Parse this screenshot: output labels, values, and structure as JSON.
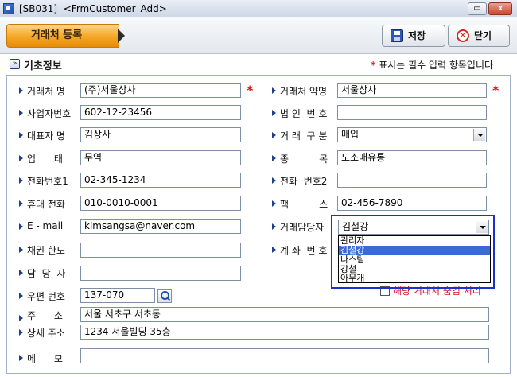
{
  "window": {
    "title": "[SB031]  <FrmCustomer_Add>",
    "close_glyph": "x",
    "restore_glyph": "▭"
  },
  "header": {
    "tab_label": "거래처 등록",
    "save_label": "저장",
    "close_label": "닫기",
    "close_icon_glyph": "✕"
  },
  "section": {
    "title": "기초정보",
    "icon_glyph": "»",
    "required_star": "*",
    "required_note": " 표시는 필수 입력 항목입니다"
  },
  "form": {
    "required_mark": "*",
    "left": [
      {
        "label": "거래처 명",
        "value": "(주)서울상사"
      },
      {
        "label": "사업자번호",
        "value": "602-12-23456"
      },
      {
        "label": "대표자 명",
        "value": "김상사"
      },
      {
        "label": "업      태",
        "value": "무역"
      },
      {
        "label": "전화번호1",
        "value": "02-345-1234"
      },
      {
        "label": "휴대 전화",
        "value": "010-0010-0001"
      },
      {
        "label": "E - mail",
        "value": "kimsangsa@naver.com"
      },
      {
        "label": "채권 한도",
        "value": ""
      },
      {
        "label": "담  당  자",
        "value": ""
      },
      {
        "label": "우편 번호",
        "value": "137-070"
      }
    ],
    "right": [
      {
        "label": "거래처 약명",
        "value": "서울상사"
      },
      {
        "label": "법 인  번 호",
        "value": ""
      },
      {
        "label": "거 래  구 분",
        "value": "매입"
      },
      {
        "label": "종          목",
        "value": "도소매유통"
      },
      {
        "label": "전화  번호2",
        "value": ""
      },
      {
        "label": "팩          스",
        "value": "02-456-7890"
      },
      {
        "label": "거래담당자",
        "value": "김철강"
      },
      {
        "label": "계 좌  번 호",
        "value": ""
      }
    ],
    "full": [
      {
        "label": "주      소",
        "value": "서울 서초구 서초동"
      },
      {
        "label": "상세 주소",
        "value": "1234 서울빌딩 35층"
      },
      {
        "label": "메      모",
        "value": ""
      }
    ],
    "manager_options": [
      "관리자",
      "김철강",
      "나스팀",
      "강철",
      "아무개"
    ],
    "hide_checkbox_label": "해당 거래처 숨김 처리"
  }
}
